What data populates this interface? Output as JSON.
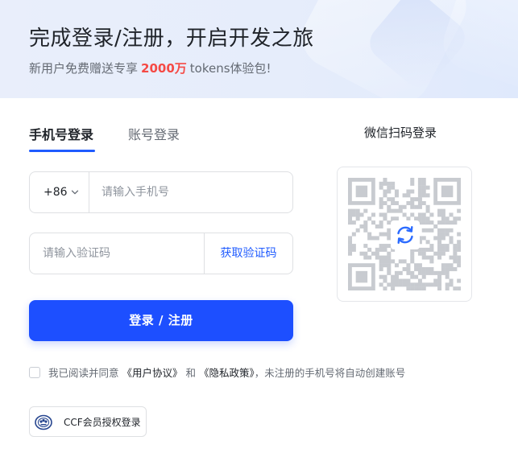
{
  "header": {
    "title": "完成登录/注册，开启开发之旅",
    "subtitle_prefix": "新用户免费赠送专享",
    "subtitle_highlight": "2000万",
    "subtitle_suffix": "tokens体验包!"
  },
  "tabs": [
    {
      "label": "手机号登录",
      "active": true
    },
    {
      "label": "账号登录",
      "active": false
    }
  ],
  "wechat": {
    "title": "微信扫码登录",
    "refresh_icon": "refresh-icon"
  },
  "phone": {
    "country_code": "+86",
    "value": "",
    "placeholder": "请输入手机号"
  },
  "code": {
    "value": "",
    "placeholder": "请输入验证码",
    "get_code_label": "获取验证码"
  },
  "submit_label": "登录 / 注册",
  "agreement": {
    "checked": false,
    "text1": "我已阅读并同意",
    "link1": "《用户协议》",
    "and": "和",
    "link2": "《隐私政策》",
    "text2": "，未注册的手机号将自动创建账号"
  },
  "ccf": {
    "label": "CCF会员授权登录",
    "logo_icon": "ccf-logo-icon"
  },
  "colors": {
    "primary": "#1d4fff",
    "highlight": "#f54a45"
  }
}
